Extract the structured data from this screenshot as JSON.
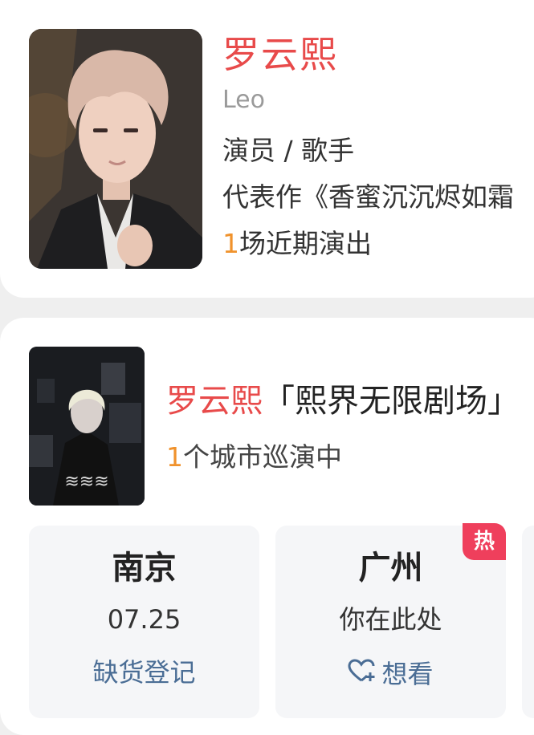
{
  "artist": {
    "name": "罗云熙",
    "english_name": "Leo",
    "roles": "演员 / 歌手",
    "works": "代表作《香蜜沉沉烬如霜",
    "upcoming_count": "1",
    "upcoming_suffix": "场近期演出"
  },
  "tour": {
    "artist": "罗云熙",
    "title": "「熙界无限剧场」",
    "city_count": "1",
    "city_suffix": "个城市巡演中"
  },
  "stops": [
    {
      "city": "南京",
      "date": "07.25",
      "action": "缺货登记"
    },
    {
      "city": "广州",
      "date": "你在此处",
      "action": "想看",
      "badge": "热"
    }
  ],
  "colors": {
    "accent": "#e84a4a",
    "orange": "#f0922c",
    "link": "#4a6d95",
    "hot": "#ef3f5c"
  }
}
